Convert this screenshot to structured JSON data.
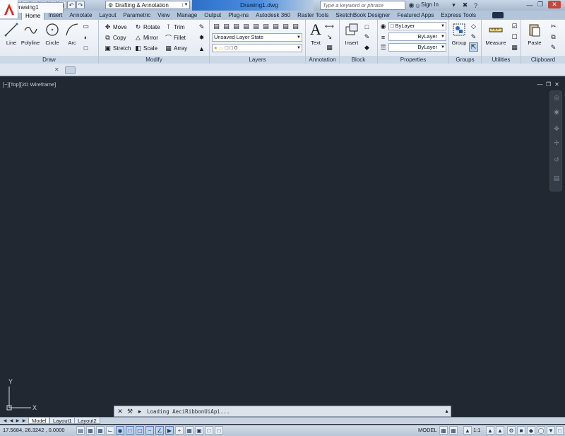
{
  "title_bar": {
    "workspace": "Drafting & Annotation",
    "doc_title": "Drawing1.dwg",
    "search_placeholder": "Type a keyword or phrase",
    "sign_in": "Sign In"
  },
  "ribbon_tabs": [
    "Home",
    "Insert",
    "Annotate",
    "Layout",
    "Parametric",
    "View",
    "Manage",
    "Output",
    "Plug-ins",
    "Autodesk 360",
    "Raster Tools",
    "SketchBook Designer",
    "Featured Apps",
    "Express Tools"
  ],
  "panels": {
    "draw": {
      "title": "Draw",
      "line": "Line",
      "polyline": "Polyline",
      "circle": "Circle",
      "arc": "Arc"
    },
    "modify": {
      "title": "Modify",
      "move": "Move",
      "rotate": "Rotate",
      "trim": "Trim",
      "copy": "Copy",
      "mirror": "Mirror",
      "fillet": "Fillet",
      "stretch": "Stretch",
      "scale": "Scale",
      "array": "Array"
    },
    "layers": {
      "title": "Layers",
      "layer_state": "Unsaved Layer State",
      "current_layer": "0"
    },
    "annotation": {
      "title": "Annotation",
      "text": "Text"
    },
    "block": {
      "title": "Block",
      "insert": "Insert"
    },
    "properties": {
      "title": "Properties",
      "color": "ByLayer",
      "linetype": "ByLayer",
      "lineweight": "ByLayer"
    },
    "groups": {
      "title": "Groups",
      "group": "Group"
    },
    "utilities": {
      "title": "Utilities",
      "measure": "Measure"
    },
    "clipboard": {
      "title": "Clipboard",
      "paste": "Paste"
    }
  },
  "file_tab": "Drawing1",
  "viewport_label": "[−][Top][2D Wireframe]",
  "ucs": {
    "x": "X",
    "y": "Y"
  },
  "command_line": {
    "text": "Loading AeciRibbonUiApi..."
  },
  "layout_tabs": [
    "Model",
    "Layout1",
    "Layout2"
  ],
  "status": {
    "coords": "17.5684, 26.3242 , 0.0000",
    "model": "MODEL",
    "scale": "1:1"
  }
}
